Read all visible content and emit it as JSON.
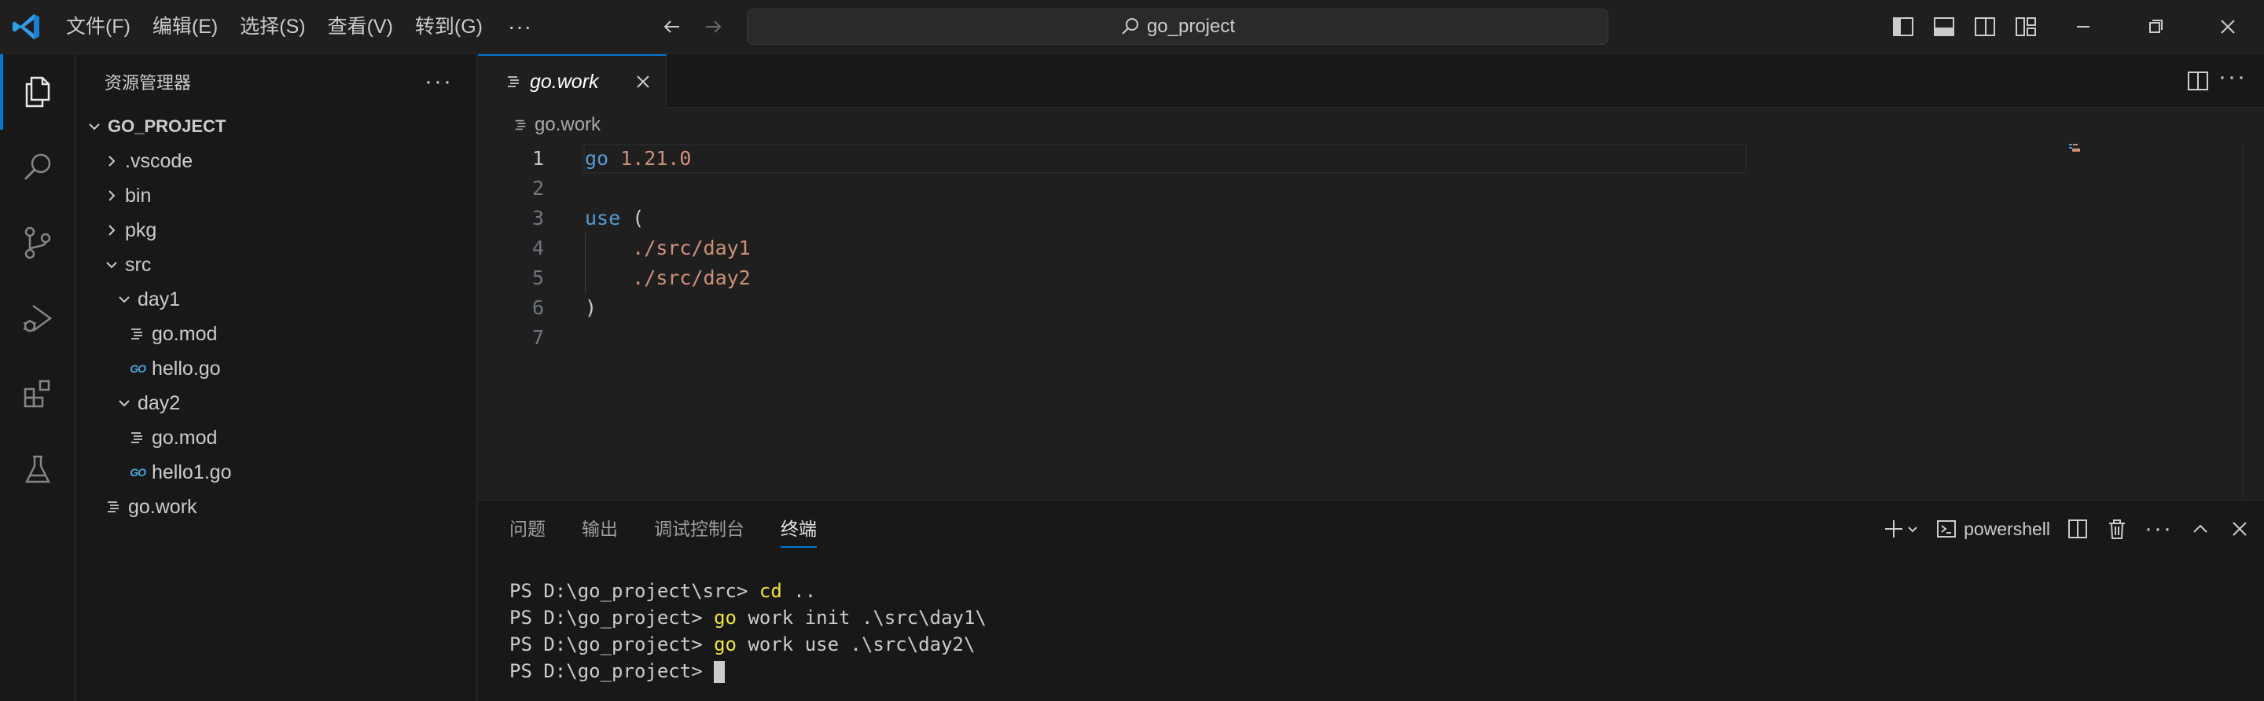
{
  "titlebar": {
    "menu": [
      "文件(F)",
      "编辑(E)",
      "选择(S)",
      "查看(V)",
      "转到(G)"
    ],
    "more": "···",
    "search_text": "go_project"
  },
  "sidebar": {
    "title": "资源管理器",
    "more": "···",
    "tree": [
      {
        "label": "GO_PROJECT",
        "type": "root",
        "expanded": true
      },
      {
        "label": ".vscode",
        "type": "folder",
        "expanded": false
      },
      {
        "label": "bin",
        "type": "folder",
        "expanded": false
      },
      {
        "label": "pkg",
        "type": "folder",
        "expanded": false
      },
      {
        "label": "src",
        "type": "folder",
        "expanded": true
      },
      {
        "label": "day1",
        "type": "folder",
        "expanded": true
      },
      {
        "label": "go.mod",
        "type": "file-lines"
      },
      {
        "label": "hello.go",
        "type": "file-go"
      },
      {
        "label": "day2",
        "type": "folder",
        "expanded": true
      },
      {
        "label": "go.mod",
        "type": "file-lines"
      },
      {
        "label": "hello1.go",
        "type": "file-go"
      },
      {
        "label": "go.work",
        "type": "file-lines"
      }
    ],
    "go_badge": "GO"
  },
  "editor": {
    "tab_name": "go.work",
    "breadcrumb": "go.work",
    "tabs_more": "···",
    "line_numbers": [
      "1",
      "2",
      "3",
      "4",
      "5",
      "6",
      "7"
    ],
    "lines": [
      [
        {
          "t": "go",
          "c": "kw"
        },
        {
          "t": " ",
          "c": "pun"
        },
        {
          "t": "1.21.0",
          "c": "str"
        }
      ],
      [],
      [
        {
          "t": "use",
          "c": "kw"
        },
        {
          "t": " (",
          "c": "pun"
        }
      ],
      [
        {
          "t": "    ",
          "c": "pun"
        },
        {
          "t": "./src/day1",
          "c": "str"
        }
      ],
      [
        {
          "t": "    ",
          "c": "pun"
        },
        {
          "t": "./src/day2",
          "c": "str"
        }
      ],
      [
        {
          "t": ")",
          "c": "pun"
        }
      ],
      []
    ],
    "current_line": 1
  },
  "panel": {
    "tabs": [
      "问题",
      "输出",
      "调试控制台",
      "终端"
    ],
    "active_tab": 3,
    "shell_label": "powershell",
    "more": "···",
    "terminal": [
      {
        "prompt": "PS D:\\go_project\\src> ",
        "cmd": "cd",
        "args": " .."
      },
      {
        "prompt": "PS D:\\go_project> ",
        "cmd": "go",
        "args": " work init .\\src\\day1\\"
      },
      {
        "prompt": "PS D:\\go_project> ",
        "cmd": "go",
        "args": " work use .\\src\\day2\\"
      },
      {
        "prompt": "PS D:\\go_project> ",
        "cmd": "",
        "args": "",
        "cursor": true
      }
    ]
  },
  "colors": {
    "accent": "#0078d4",
    "keyword": "#569cd6",
    "string": "#ce9178",
    "terminal_command": "#f0e441"
  }
}
